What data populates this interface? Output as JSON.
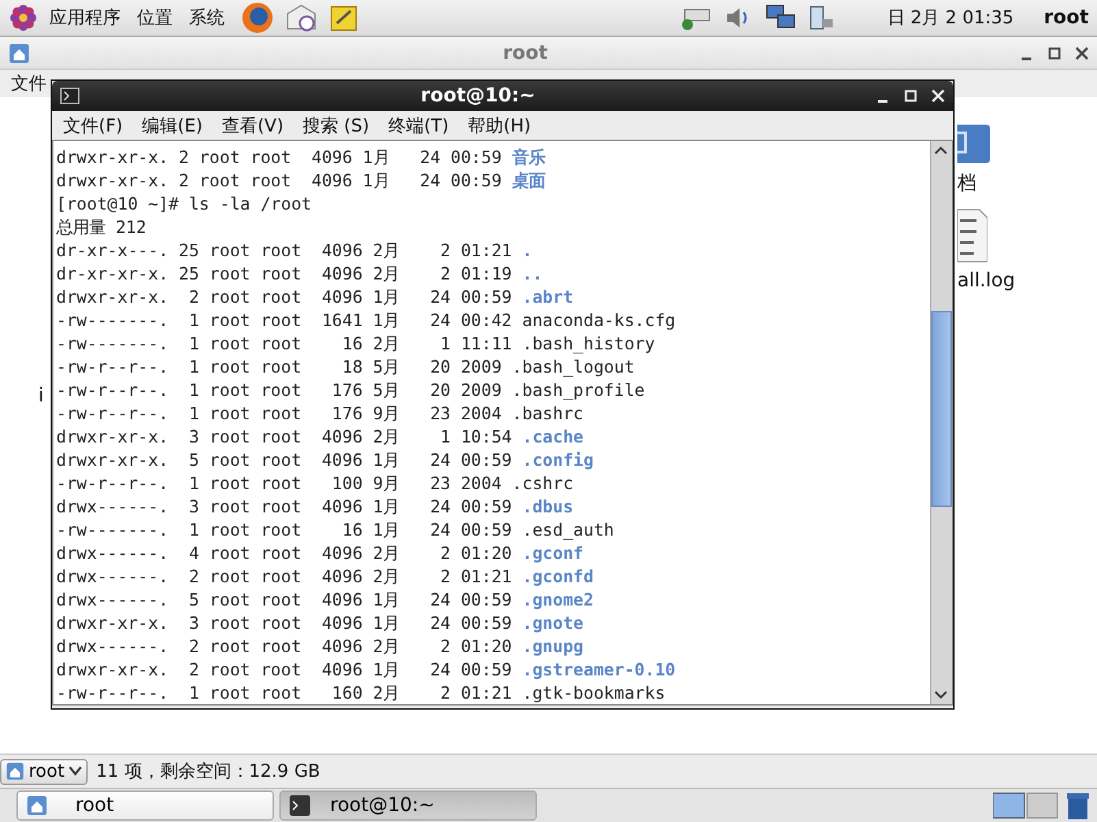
{
  "top_panel": {
    "menus": [
      "应用程序",
      "位置",
      "系统"
    ],
    "clock": "日 2月  2 01:35",
    "user": "root"
  },
  "file_manager": {
    "title": "root",
    "menu_fragment": "文件",
    "side_fragment": "i",
    "desktop_items": [
      {
        "label": "档",
        "kind": "folder"
      },
      {
        "label": "all.log",
        "kind": "textfile"
      }
    ],
    "status": {
      "location": "root",
      "info": "11 项，剩余空间：12.9 GB"
    }
  },
  "terminal": {
    "title": "root@10:~",
    "menus": [
      "文件(F)",
      "编辑(E)",
      "查看(V)",
      "搜索 (S)",
      "终端(T)",
      "帮助(H)"
    ],
    "lines": [
      {
        "text": "drwxr-xr-x. 2 root root  4096 1月   24 00:59 ",
        "name": "音乐",
        "kind": "dir"
      },
      {
        "text": "drwxr-xr-x. 2 root root  4096 1月   24 00:59 ",
        "name": "桌面",
        "kind": "dir"
      },
      {
        "text": "[root@10 ~]# ls -la /root",
        "kind": "plain"
      },
      {
        "text": "总用量 212",
        "kind": "plain"
      },
      {
        "text": "dr-xr-x---. 25 root root  4096 2月    2 01:21 ",
        "name": ".",
        "kind": "dir"
      },
      {
        "text": "dr-xr-xr-x. 25 root root  4096 2月    2 01:19 ",
        "name": "..",
        "kind": "dir"
      },
      {
        "text": "drwxr-xr-x.  2 root root  4096 1月   24 00:59 ",
        "name": ".abrt",
        "kind": "dir"
      },
      {
        "text": "-rw-------.  1 root root  1641 1月   24 00:42 ",
        "name": "anaconda-ks.cfg",
        "kind": "file"
      },
      {
        "text": "-rw-------.  1 root root    16 2月    1 11:11 ",
        "name": ".bash_history",
        "kind": "file"
      },
      {
        "text": "-rw-r--r--.  1 root root    18 5月   20 2009 ",
        "name": ".bash_logout",
        "kind": "file"
      },
      {
        "text": "-rw-r--r--.  1 root root   176 5月   20 2009 ",
        "name": ".bash_profile",
        "kind": "file"
      },
      {
        "text": "-rw-r--r--.  1 root root   176 9月   23 2004 ",
        "name": ".bashrc",
        "kind": "file"
      },
      {
        "text": "drwxr-xr-x.  3 root root  4096 2月    1 10:54 ",
        "name": ".cache",
        "kind": "dir"
      },
      {
        "text": "drwxr-xr-x.  5 root root  4096 1月   24 00:59 ",
        "name": ".config",
        "kind": "dir"
      },
      {
        "text": "-rw-r--r--.  1 root root   100 9月   23 2004 ",
        "name": ".cshrc",
        "kind": "file"
      },
      {
        "text": "drwx------.  3 root root  4096 1月   24 00:59 ",
        "name": ".dbus",
        "kind": "dir"
      },
      {
        "text": "-rw-------.  1 root root    16 1月   24 00:59 ",
        "name": ".esd_auth",
        "kind": "file"
      },
      {
        "text": "drwx------.  4 root root  4096 2月    2 01:20 ",
        "name": ".gconf",
        "kind": "dir"
      },
      {
        "text": "drwx------.  2 root root  4096 2月    2 01:21 ",
        "name": ".gconfd",
        "kind": "dir"
      },
      {
        "text": "drwx------.  5 root root  4096 1月   24 00:59 ",
        "name": ".gnome2",
        "kind": "dir"
      },
      {
        "text": "drwxr-xr-x.  3 root root  4096 1月   24 00:59 ",
        "name": ".gnote",
        "kind": "dir"
      },
      {
        "text": "drwx------.  2 root root  4096 2月    2 01:20 ",
        "name": ".gnupg",
        "kind": "dir"
      },
      {
        "text": "drwxr-xr-x.  2 root root  4096 1月   24 00:59 ",
        "name": ".gstreamer-0.10",
        "kind": "dir"
      },
      {
        "text": "-rw-r--r--.  1 root root   160 2月    2 01:21 ",
        "name": ".gtk-bookmarks",
        "kind": "file"
      }
    ]
  },
  "taskbar": [
    {
      "label": "root",
      "kind": "folder",
      "selected": false
    },
    {
      "label": "root@10:~",
      "kind": "terminal",
      "selected": true
    }
  ]
}
